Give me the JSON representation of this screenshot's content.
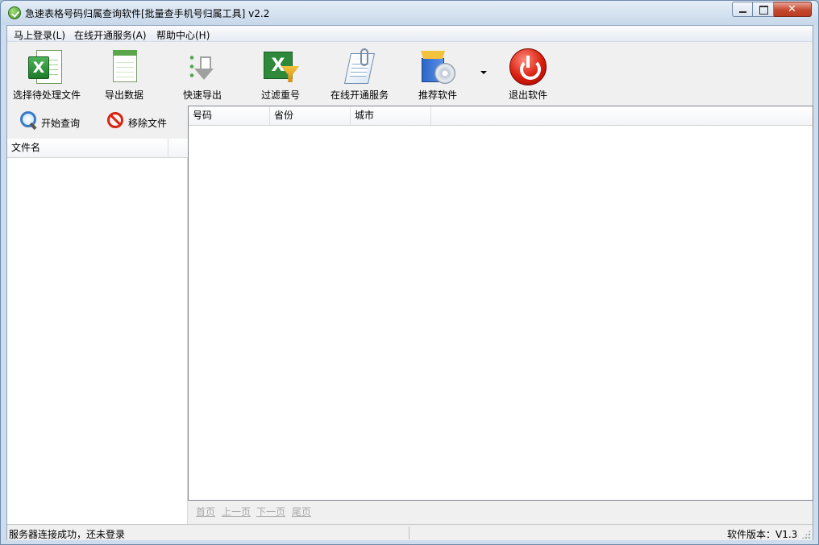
{
  "window": {
    "title": "急速表格号码归属查询软件[批量查手机号归属工具] v2.2",
    "close_glyph": "✕"
  },
  "menu": [
    {
      "label": "马上登录(L)"
    },
    {
      "label": "在线开通服务(A)"
    },
    {
      "label": "帮助中心(H)"
    }
  ],
  "toolbar": [
    {
      "label": "选择待处理文件",
      "icon": "excel-open-icon"
    },
    {
      "label": "导出数据",
      "icon": "spreadsheet-icon"
    },
    {
      "label": "快速导出",
      "icon": "download-arrow-icon"
    },
    {
      "label": "过滤重号",
      "icon": "excel-filter-icon"
    },
    {
      "label": "在线开通服务",
      "icon": "document-clip-icon"
    },
    {
      "label": "推荐软件",
      "icon": "software-box-icon"
    },
    {
      "label": "退出软件",
      "icon": "power-icon"
    }
  ],
  "left_panel": {
    "start_query": "开始查询",
    "remove_file": "移除文件",
    "column_filename": "文件名"
  },
  "results": {
    "columns": [
      "号码",
      "省份",
      "城市"
    ]
  },
  "pager": {
    "first": "首页",
    "prev": "上一页",
    "next": "下一页",
    "last": "尾页"
  },
  "status": {
    "left": "服务器连接成功，还未登录",
    "right": "软件版本：V1.3"
  },
  "colors": {
    "accent_blue": "#cfdcec",
    "close_red": "#c4492f",
    "excel_green": "#2e8a3a",
    "power_red": "#d81c0c"
  }
}
